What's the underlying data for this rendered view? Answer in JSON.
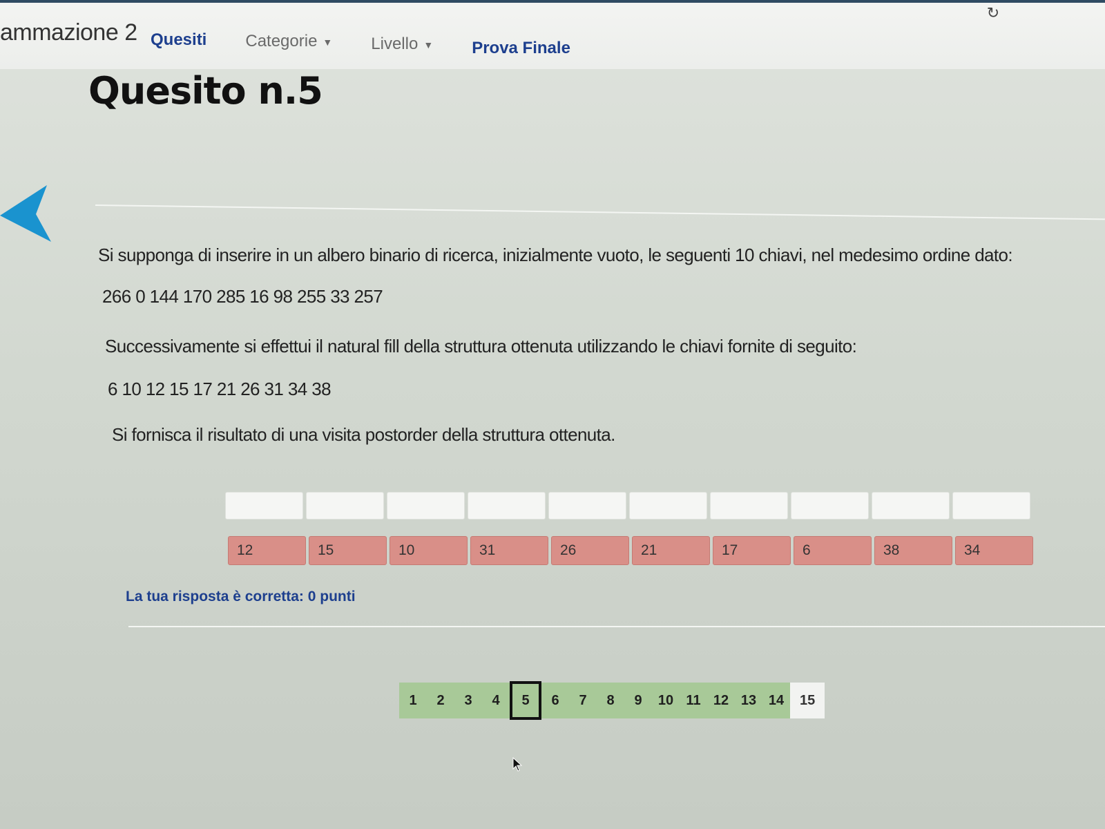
{
  "header": {
    "brand": "ammazione 2",
    "nav": {
      "quesiti": "Quesiti",
      "categorie": "Categorie",
      "livello": "Livello",
      "prova_finale": "Prova Finale"
    }
  },
  "question": {
    "title": "Quesito n.5",
    "intro": "Si supponga di inserire in un albero binario di ricerca, inizialmente vuoto, le seguenti 10 chiavi, nel medesimo ordine dato:",
    "initial_keys": "266 0 144 170 285 16 98 255 33 257",
    "fill_text": "Successivamente si effettui il natural fill della struttura ottenuta utilizzando le chiavi fornite di seguito:",
    "fill_keys": "6 10 12 15 17 21 26 31 34 38",
    "request": "Si fornisca il risultato di una visita postorder della struttura ottenuta."
  },
  "answer": {
    "slots_count": 10,
    "keys": [
      "12",
      "15",
      "10",
      "31",
      "26",
      "21",
      "17",
      "6",
      "38",
      "34"
    ],
    "key_color": "#d98f88",
    "result_text": "La tua risposta è corretta: 0 punti"
  },
  "pagination": {
    "pages": [
      "1",
      "2",
      "3",
      "4",
      "5",
      "6",
      "7",
      "8",
      "9",
      "10",
      "11",
      "12",
      "13",
      "14",
      "15"
    ],
    "current": "5",
    "done_color": "#a8c998"
  },
  "icons": {
    "reload": "reload-icon",
    "back": "back-arrow-icon",
    "caret": "caret-down-icon"
  },
  "colors": {
    "accent": "#1d3f8e",
    "arrow": "#1a93cf"
  }
}
